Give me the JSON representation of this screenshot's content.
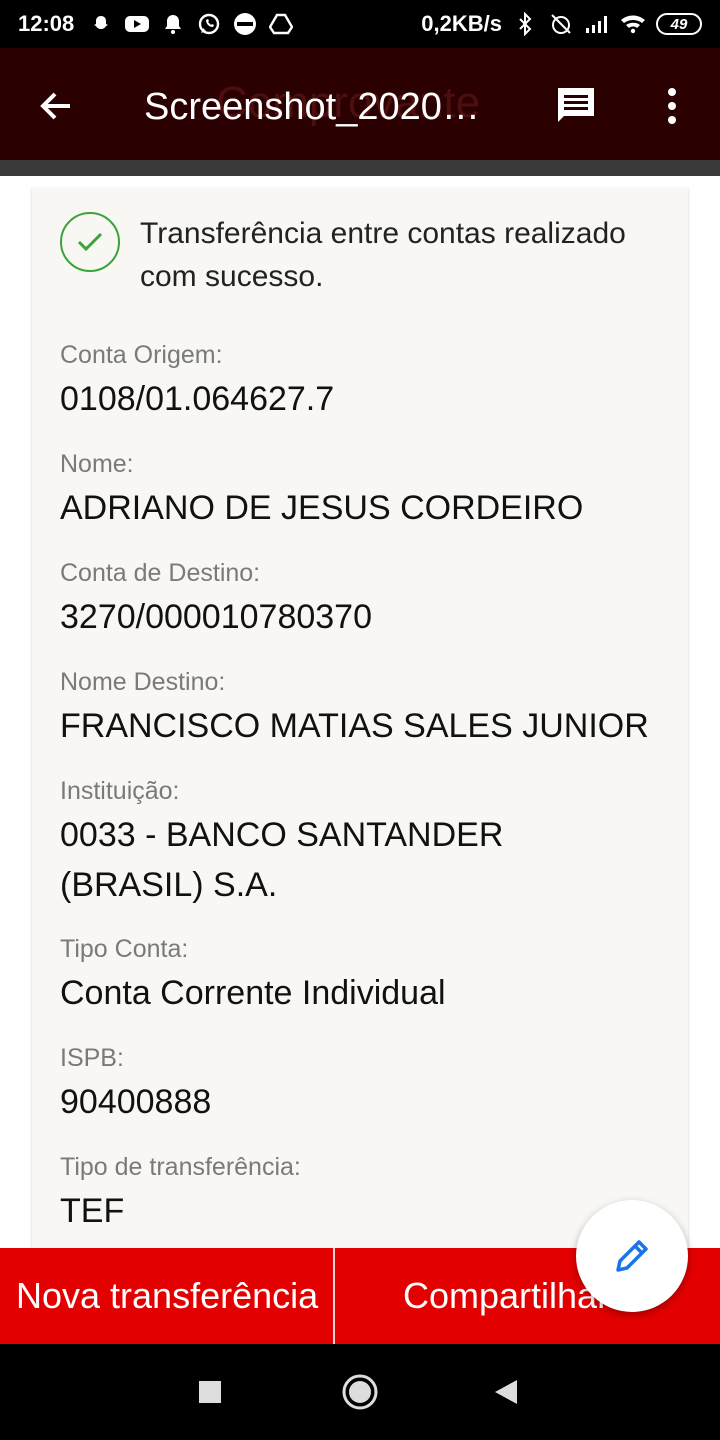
{
  "status_bar": {
    "time": "12:08",
    "net_speed": "0,2KB/s",
    "battery": "49",
    "left_icons": [
      "snapchat-icon",
      "youtube-icon",
      "bell-icon",
      "whatsapp-icon",
      "bet365-icon",
      "drive-icon"
    ],
    "right_icons": [
      "bluetooth-icon",
      "alarm-off-icon",
      "signal-icon",
      "wifi-icon",
      "battery-icon"
    ]
  },
  "app_bar": {
    "title": "Screenshot_2020…",
    "ghost_title": "Comprovante",
    "back_icon": "arrow-left-icon",
    "message_icon": "message-icon",
    "more_icon": "more-vert-icon",
    "bg_color": "#2a0000"
  },
  "receipt": {
    "success_message": "Transferência entre contas realizado com sucesso.",
    "fields": [
      {
        "label": "Conta Origem:",
        "value": "0108/01.064627.7"
      },
      {
        "label": "Nome:",
        "value": "ADRIANO DE JESUS CORDEIRO"
      },
      {
        "label": "Conta de Destino:",
        "value": "3270/000010780370"
      },
      {
        "label": "Nome Destino:",
        "value": "FRANCISCO MATIAS SALES JUNIOR"
      },
      {
        "label": "Instituição:",
        "value": "0033 - BANCO SANTANDER (BRASIL) S.A."
      },
      {
        "label": "Tipo Conta:",
        "value": "Conta Corrente Individual"
      },
      {
        "label": "ISPB:",
        "value": "90400888"
      },
      {
        "label": "Tipo de transferência:",
        "value": "TEF"
      }
    ]
  },
  "actions": {
    "new_transfer": "Nova transferência",
    "share": "Compartilhar",
    "bg_color": "#e30000"
  },
  "fab": {
    "icon": "pencil-icon",
    "color": "#1a73e8"
  },
  "nav_bar": {
    "icons": [
      "recents-square-icon",
      "home-circle-icon",
      "back-triangle-icon"
    ]
  }
}
